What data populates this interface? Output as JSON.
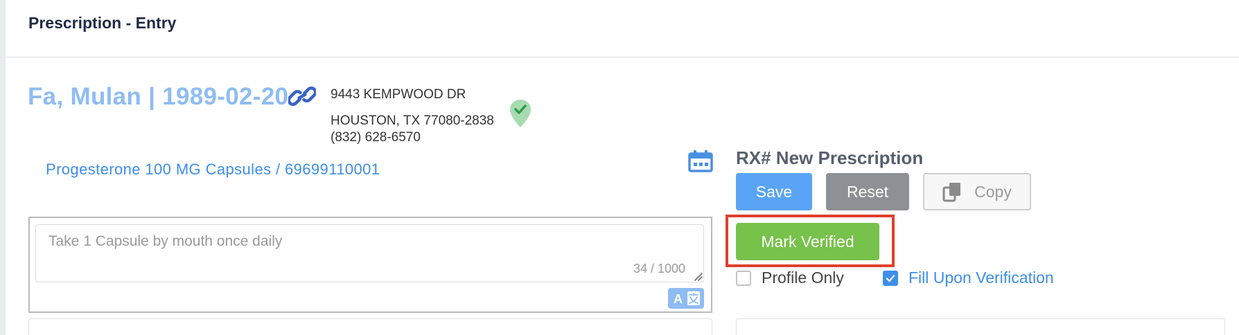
{
  "header": {
    "title": "Prescription - Entry"
  },
  "patient": {
    "name_dob": "Fa, Mulan | 1989-02-20",
    "address_line1": "9443 KEMPWOOD DR",
    "address_line2": "HOUSTON, TX 77080-2838",
    "phone": "(832) 628-6570",
    "link_icon": "link-icon",
    "location_icon": "map-pin-check-icon"
  },
  "drug": {
    "label": "Progesterone 100 MG Capsules / 69699110001"
  },
  "sig": {
    "value": "Take 1 Capsule by mouth once daily",
    "counter": "34 / 1000"
  },
  "rx": {
    "title": "RX# New Prescription"
  },
  "actions": {
    "save_label": "Save",
    "reset_label": "Reset",
    "copy_label": "Copy",
    "verify_label": "Mark Verified"
  },
  "options": {
    "profile_only_label": "Profile Only",
    "profile_only_checked": false,
    "fill_upon_verification_label": "Fill Upon Verification",
    "fill_upon_verification_checked": true
  },
  "colors": {
    "accent_blue": "#3d8fe8",
    "save_blue": "#5aa4f5",
    "verify_green": "#76c24a",
    "reset_gray": "#8e9096",
    "highlight_red": "#e0402a",
    "patient_name": "#8fbcf2"
  }
}
